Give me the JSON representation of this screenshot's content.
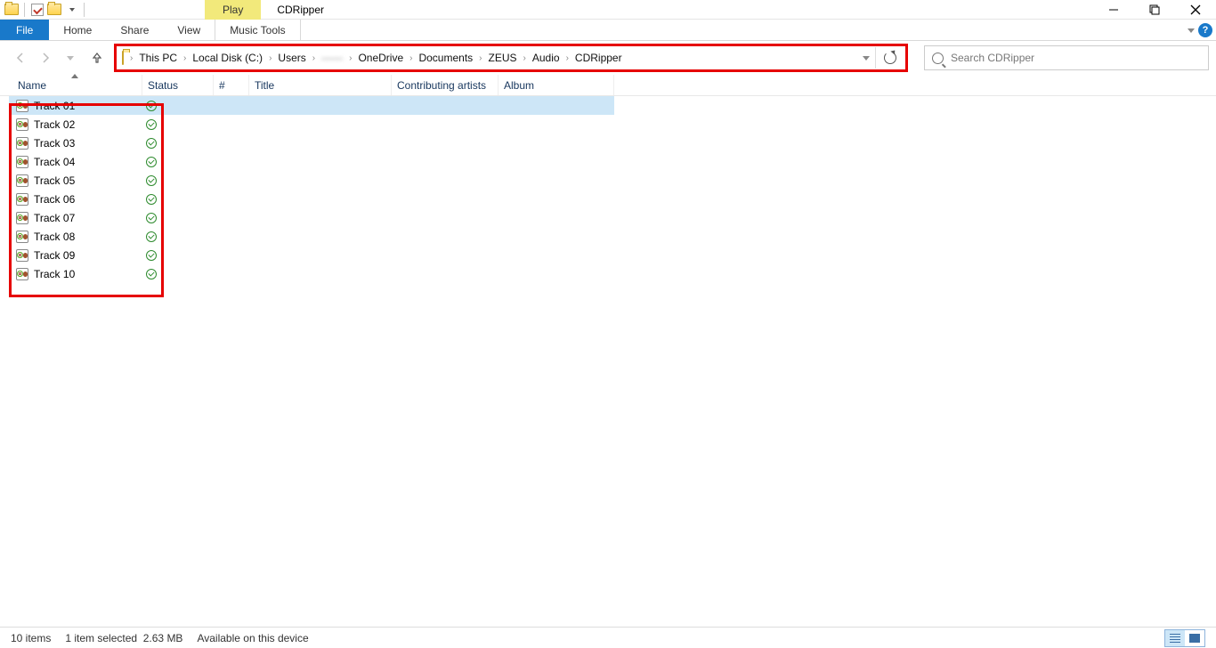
{
  "window": {
    "context_tab": "Play",
    "title": "CDRipper"
  },
  "ribbon": {
    "file": "File",
    "home": "Home",
    "share": "Share",
    "view": "View",
    "music_tools": "Music Tools"
  },
  "breadcrumb": {
    "segments": [
      "This PC",
      "Local Disk (C:)",
      "Users",
      "——",
      "OneDrive",
      "Documents",
      "ZEUS",
      "Audio",
      "CDRipper"
    ]
  },
  "search": {
    "placeholder": "Search CDRipper"
  },
  "columns": {
    "name": "Name",
    "status": "Status",
    "num": "#",
    "title": "Title",
    "artists": "Contributing artists",
    "album": "Album"
  },
  "files": [
    {
      "name": "Track 01",
      "selected": true
    },
    {
      "name": "Track 02",
      "selected": false
    },
    {
      "name": "Track 03",
      "selected": false
    },
    {
      "name": "Track 04",
      "selected": false
    },
    {
      "name": "Track 05",
      "selected": false
    },
    {
      "name": "Track 06",
      "selected": false
    },
    {
      "name": "Track 07",
      "selected": false
    },
    {
      "name": "Track 08",
      "selected": false
    },
    {
      "name": "Track 09",
      "selected": false
    },
    {
      "name": "Track 10",
      "selected": false
    }
  ],
  "statusbar": {
    "item_count": "10 items",
    "selection": "1 item selected",
    "size": "2.63 MB",
    "availability": "Available on this device"
  }
}
